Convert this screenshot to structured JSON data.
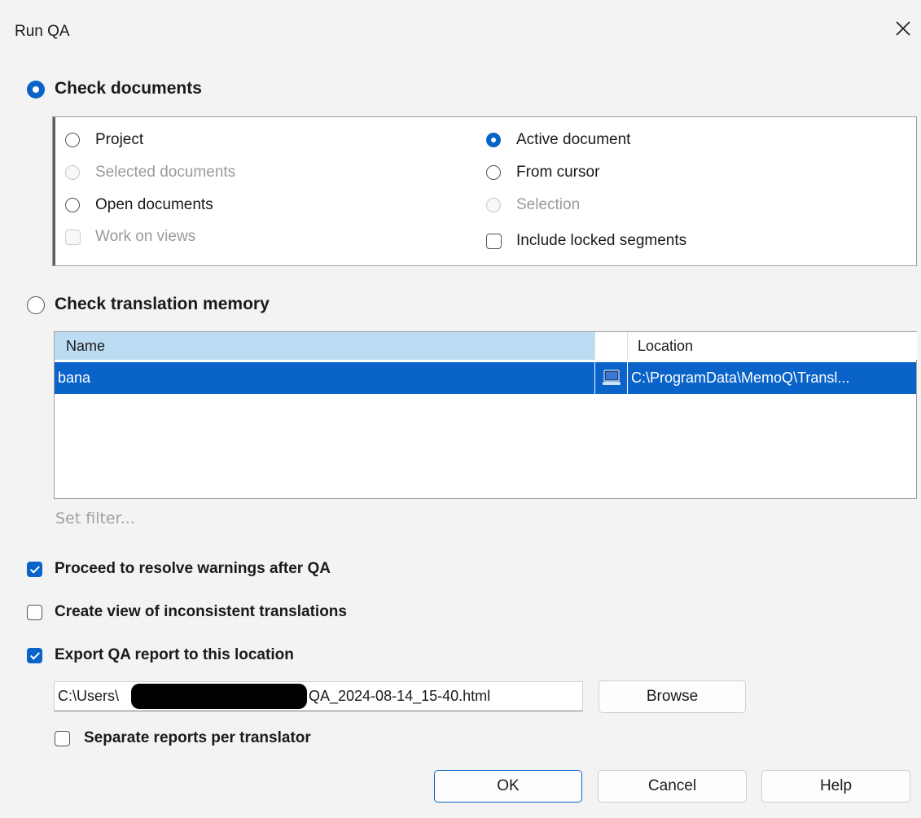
{
  "window": {
    "title": "Run QA"
  },
  "check_documents": {
    "label": "Check documents",
    "selected": true,
    "options_left": [
      {
        "label": "Project",
        "kind": "radio",
        "checked": false,
        "disabled": false
      },
      {
        "label": "Selected documents",
        "kind": "radio",
        "checked": false,
        "disabled": true
      },
      {
        "label": "Open documents",
        "kind": "radio",
        "checked": false,
        "disabled": false
      },
      {
        "label": "Work on views",
        "kind": "checkbox",
        "checked": false,
        "disabled": true
      }
    ],
    "options_right": [
      {
        "label": "Active document",
        "kind": "radio",
        "checked": true,
        "disabled": false
      },
      {
        "label": "From cursor",
        "kind": "radio",
        "checked": false,
        "disabled": false
      },
      {
        "label": "Selection",
        "kind": "radio",
        "checked": false,
        "disabled": true
      },
      {
        "label": "Include locked segments",
        "kind": "checkbox",
        "checked": false,
        "disabled": false
      }
    ]
  },
  "check_tm": {
    "label": "Check translation memory",
    "selected": false,
    "columns": {
      "name": "Name",
      "location": "Location"
    },
    "rows": [
      {
        "name": "bana",
        "icon": "computer-icon",
        "location": "C:\\ProgramData\\MemoQ\\Transl..."
      }
    ],
    "set_filter": "Set filter..."
  },
  "options": {
    "resolve_warnings": {
      "label": "Proceed to resolve warnings after QA",
      "checked": true
    },
    "inconsistent_view": {
      "label": "Create view of inconsistent translations",
      "checked": false
    },
    "export_report": {
      "label": "Export QA report to this location",
      "checked": true
    },
    "report_path_start": "C:\\Users\\",
    "report_path_end": "QA_2024-08-14_15-40.html",
    "browse": "Browse",
    "separate_reports": {
      "label": "Separate reports per translator",
      "checked": false
    }
  },
  "buttons": {
    "ok": "OK",
    "cancel": "Cancel",
    "help": "Help"
  },
  "colors": {
    "accent": "#0a63c9",
    "header_selected": "#bcdcf4"
  }
}
